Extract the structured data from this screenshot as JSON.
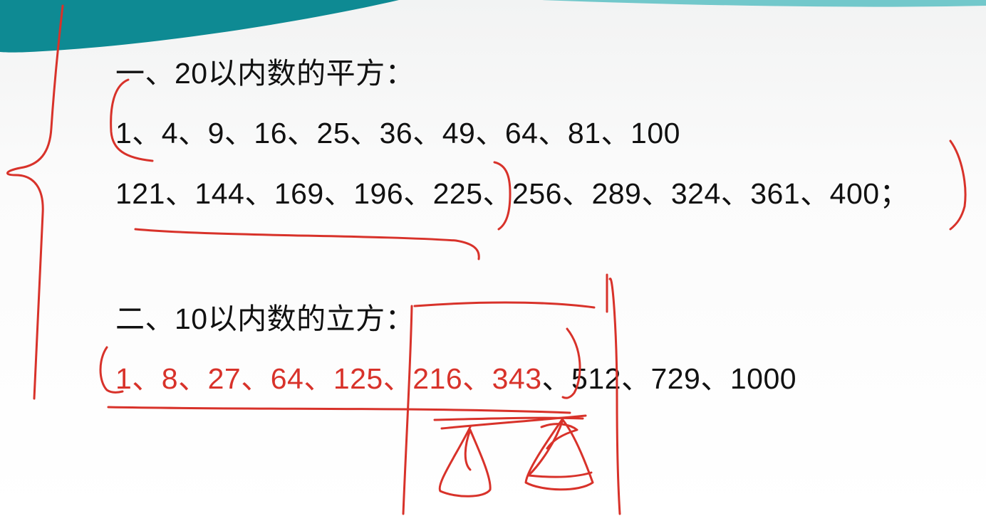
{
  "slide": {
    "section1": {
      "heading": "一、20以内数的平方：",
      "row1": "1、4、9、16、25、36、49、64、81、100",
      "row2": "121、144、169、196、225、256、289、324、361、400；"
    },
    "section2": {
      "heading": "二、10以内数的立方：",
      "row_highlighted": "1、8、27、64、125、216、343",
      "row_rest": "、512、729、1000"
    }
  },
  "colors": {
    "header_teal": "#0e8a93",
    "header_teal_light": "#4cb9bd",
    "annotation_red": "#d8322a",
    "text": "#111111"
  }
}
